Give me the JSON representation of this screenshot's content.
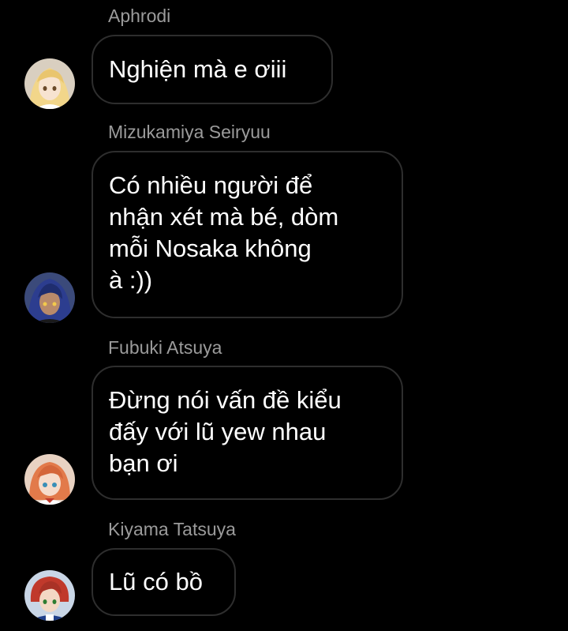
{
  "messages": [
    {
      "sender": "Aphrodi",
      "text": "Nghiện mà e ơiii",
      "avatar_icon": "blonde-anime-avatar-icon",
      "avatar_colors": {
        "bg": "#d9cfc0",
        "hair": "#f2d68a",
        "skin": "#f7e3d0"
      }
    },
    {
      "sender": "Mizukamiya Seiryuu",
      "text": "Có nhiều người để\nnhận xét mà bé, dòm\nmỗi Nosaka không\nà :))",
      "avatar_icon": "blue-hair-anime-avatar-icon",
      "avatar_colors": {
        "bg": "#3b4a7a",
        "hair": "#2c3d8f",
        "skin": "#b98a6a"
      }
    },
    {
      "sender": "Fubuki Atsuya",
      "text": "Đừng nói vấn đề kiểu\nđấy với lũ yew nhau\nbạn ơi",
      "avatar_icon": "orange-hair-anime-avatar-icon",
      "avatar_colors": {
        "bg": "#e8d2c2",
        "hair": "#e27a4a",
        "skin": "#f6dccb"
      }
    },
    {
      "sender": "Kiyama Tatsuya",
      "text": "Lũ có bồ",
      "avatar_icon": "red-hair-anime-avatar-icon",
      "avatar_colors": {
        "bg": "#c9d6e6",
        "hair": "#c0392b",
        "skin": "#f3d8c4"
      }
    }
  ]
}
